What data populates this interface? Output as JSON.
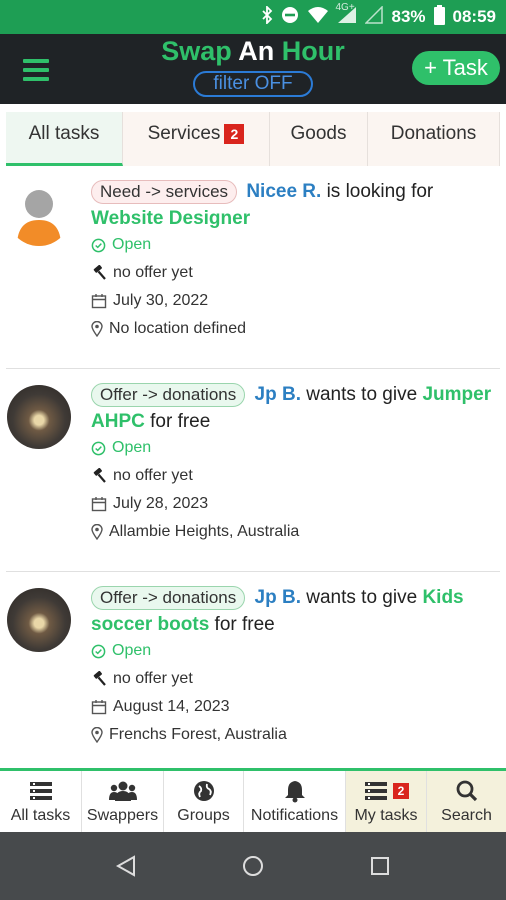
{
  "status_bar": {
    "network": "4G+",
    "battery": "83%",
    "time": "08:59"
  },
  "app_bar": {
    "title_part1": "Swap",
    "title_part2": "An",
    "title_part3": "Hour",
    "filter": "filter OFF",
    "add_task": "+ Task"
  },
  "tabs": [
    {
      "label": "All tasks",
      "badge": ""
    },
    {
      "label": "Services",
      "badge": "2"
    },
    {
      "label": "Goods",
      "badge": ""
    },
    {
      "label": "Donations",
      "badge": ""
    }
  ],
  "tasks": [
    {
      "type": "Need -> services",
      "user": "Nicee R.",
      "verb": "is looking for",
      "item": "Website Designer",
      "suffix": "",
      "status": "Open",
      "offers": "no offer yet",
      "date": "July 30, 2022",
      "location": "No location defined"
    },
    {
      "type": "Offer -> donations",
      "user": "Jp B.",
      "verb": "wants to give",
      "item": "Jumper AHPC",
      "suffix": "for free",
      "status": "Open",
      "offers": "no offer yet",
      "date": "July 28, 2023",
      "location": "Allambie Heights, Australia"
    },
    {
      "type": "Offer -> donations",
      "user": "Jp B.",
      "verb": "wants to give",
      "item": "Kids soccer boots",
      "suffix": "for free",
      "status": "Open",
      "offers": "no offer yet",
      "date": "August 14, 2023",
      "location": "Frenchs Forest, Australia"
    }
  ],
  "bottom_nav": [
    {
      "label": "All tasks",
      "icon": "list-icon",
      "badge": ""
    },
    {
      "label": "Swappers",
      "icon": "users-icon",
      "badge": ""
    },
    {
      "label": "Groups",
      "icon": "globe-icon",
      "badge": ""
    },
    {
      "label": "Notifications",
      "icon": "bell-icon",
      "badge": ""
    },
    {
      "label": "My tasks",
      "icon": "list-icon",
      "badge": "2"
    },
    {
      "label": "Search",
      "icon": "search-icon",
      "badge": ""
    }
  ],
  "colors": {
    "accent_green": "#2fc06a",
    "status_bar": "#1e9e54",
    "app_bar": "#1f2326",
    "link_blue": "#2c7fc2",
    "badge_red": "#d9251d"
  }
}
